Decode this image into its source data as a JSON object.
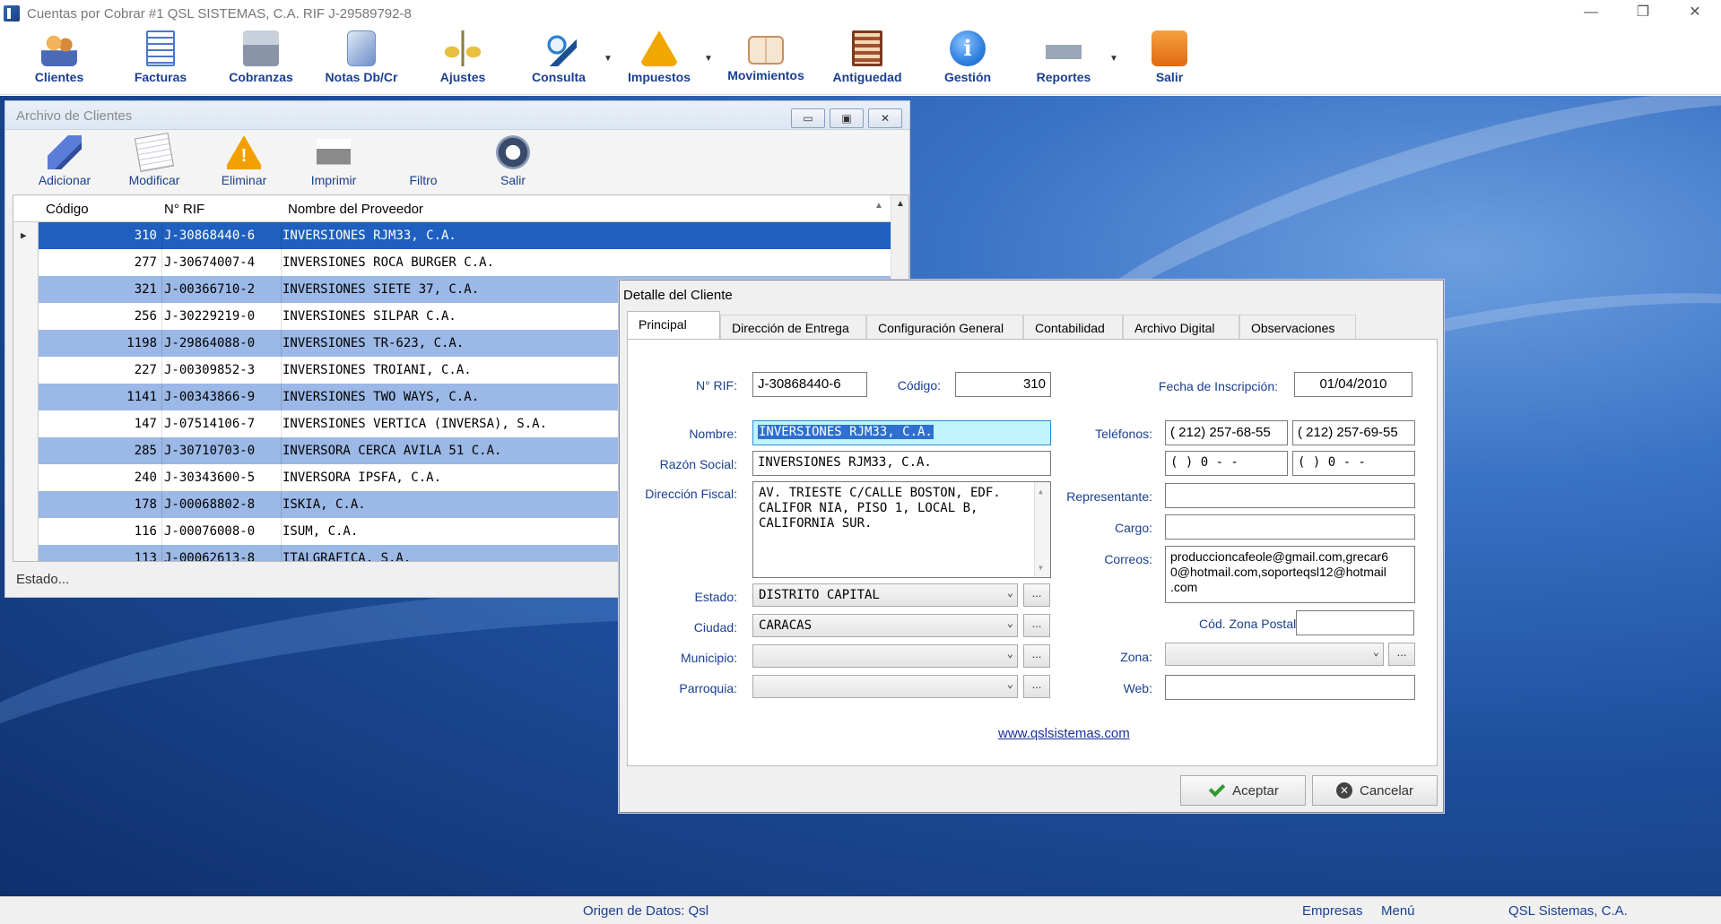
{
  "window": {
    "title": "Cuentas por Cobrar   #1  QSL SISTEMAS, C.A.   RIF J-29589792-8",
    "controls": [
      "—",
      "❐",
      "✕"
    ]
  },
  "toolbar": [
    {
      "label": "Clientes",
      "icon": "people-icon",
      "color": "#d9822b"
    },
    {
      "label": "Facturas",
      "icon": "invoice-icon",
      "color": "#4a78c8"
    },
    {
      "label": "Cobranzas",
      "icon": "cash-register-icon",
      "color": "#8a96a8"
    },
    {
      "label": "Notas Db/Cr",
      "icon": "notes-icon",
      "color": "#6d8fc8"
    },
    {
      "label": "Ajustes",
      "icon": "scale-icon",
      "color": "#c8a030"
    },
    {
      "label": "Consulta",
      "icon": "magnifier-icon",
      "color": "#2f7fd0"
    },
    {
      "label": "Impuestos",
      "icon": "lightning-icon",
      "color": "#f0a800"
    },
    {
      "label": "Movimientos",
      "icon": "book-icon",
      "color": "#c89060"
    },
    {
      "label": "Antiguedad",
      "icon": "abacus-icon",
      "color": "#a05030"
    },
    {
      "label": "Gestión",
      "icon": "info-icon",
      "color": "#2f7fe0"
    },
    {
      "label": "Reportes",
      "icon": "printer-icon",
      "color": "#8a9ab0"
    },
    {
      "label": "Salir",
      "icon": "lock-icon",
      "color": "#f08020"
    }
  ],
  "clients_window": {
    "title": "Archivo de Clientes",
    "buttons": [
      {
        "label": "Adicionar",
        "icon": "add-brush-icon"
      },
      {
        "label": "Modificar",
        "icon": "edit-icon"
      },
      {
        "label": "Eliminar",
        "icon": "warning-icon"
      },
      {
        "label": "Imprimir",
        "icon": "printer-icon"
      },
      {
        "label": "Filtro",
        "icon": "funnel-icon"
      },
      {
        "label": "Salir",
        "icon": "power-icon"
      }
    ],
    "columns": [
      "Código",
      "N° RIF",
      "Nombre del Proveedor"
    ],
    "rows": [
      {
        "codigo": "310",
        "rif": "J-30868440-6",
        "nombre": "INVERSIONES RJM33, C.A."
      },
      {
        "codigo": "277",
        "rif": "J-30674007-4",
        "nombre": "INVERSIONES ROCA BURGER C.A."
      },
      {
        "codigo": "321",
        "rif": "J-00366710-2",
        "nombre": "INVERSIONES SIETE 37, C.A."
      },
      {
        "codigo": "256",
        "rif": "J-30229219-0",
        "nombre": "INVERSIONES SILPAR C.A."
      },
      {
        "codigo": "1198",
        "rif": "J-29864088-0",
        "nombre": "INVERSIONES TR-623, C.A."
      },
      {
        "codigo": "227",
        "rif": "J-00309852-3",
        "nombre": "INVERSIONES TROIANI, C.A."
      },
      {
        "codigo": "1141",
        "rif": "J-00343866-9",
        "nombre": "INVERSIONES TWO WAYS, C.A."
      },
      {
        "codigo": "147",
        "rif": "J-07514106-7",
        "nombre": "INVERSIONES VERTICA (INVERSA), S.A."
      },
      {
        "codigo": "285",
        "rif": "J-30710703-0",
        "nombre": "INVERSORA CERCA AVILA 51 C.A."
      },
      {
        "codigo": "240",
        "rif": "J-30343600-5",
        "nombre": "INVERSORA IPSFA, C.A."
      },
      {
        "codigo": "178",
        "rif": "J-00068802-8",
        "nombre": "ISKIA, C.A."
      },
      {
        "codigo": "116",
        "rif": "J-00076008-0",
        "nombre": "ISUM, C.A."
      },
      {
        "codigo": "113",
        "rif": "J-00062613-8",
        "nombre": "ITALGRAFICA, S.A."
      }
    ],
    "status": "Estado..."
  },
  "dialog": {
    "title": "Detalle del Cliente",
    "tabs": [
      "Principal",
      "Dirección de Entrega",
      "Configuración General",
      "Contabilidad",
      "Archivo Digital",
      "Observaciones"
    ],
    "labels": {
      "rif": "N° RIF:",
      "codigo": "Código:",
      "fecha": "Fecha de Inscripción:",
      "nombre": "Nombre:",
      "telefonos": "Teléfonos:",
      "razon": "Razón Social:",
      "direccion": "Dirección Fiscal:",
      "representante": "Representante:",
      "cargo": "Cargo:",
      "correos": "Correos:",
      "estado": "Estado:",
      "ciudad": "Ciudad:",
      "zona_postal": "Cód. Zona Postal :",
      "municipio": "Municipio:",
      "zona": "Zona:",
      "parroquia": "Parroquia:",
      "web": "Web:"
    },
    "values": {
      "rif": "J-30868440-6",
      "codigo": "310",
      "fecha": "01/04/2010",
      "nombre": "INVERSIONES RJM33, C.A.",
      "tel1": "( 212) 257-68-55",
      "tel2": "( 212) 257-69-55",
      "tel3": "(    ) 0  -  -",
      "tel4": "(    ) 0  -  -",
      "razon": "INVERSIONES RJM33, C.A.",
      "direccion": "AV. TRIESTE C/CALLE BOSTON, EDF.\nCALIFOR NIA, PISO 1, LOCAL B,\nCALIFORNIA SUR.",
      "representante": "",
      "cargo": "",
      "correos": "produccioncafeole@gmail.com,grecar6\n0@hotmail.com,soporteqsl12@hotmail\n.com",
      "estado": "DISTRITO CAPITAL",
      "ciudad": "CARACAS",
      "zona_postal": "",
      "municipio": "",
      "zona": "",
      "parroquia": "",
      "web": ""
    },
    "ellipsis": "...",
    "link": "www.qslsistemas.com",
    "accept": "Aceptar",
    "cancel": "Cancelar"
  },
  "statusbar": {
    "origen": "Origen de Datos: Qsl",
    "empresas": "Empresas",
    "menu": "Menú",
    "company": "QSL Sistemas, C.A."
  }
}
